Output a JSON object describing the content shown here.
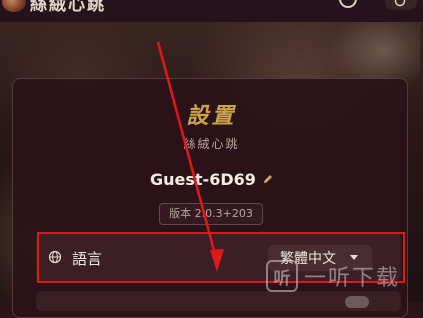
{
  "header": {
    "app_title": "絲絨心跳"
  },
  "settings": {
    "title": "設置",
    "subtitle": "絲絨心跳",
    "username": "Guest-6D69",
    "version": "版本 2.0.3+203",
    "language": {
      "label": "語言",
      "selected": "繁體中文"
    }
  },
  "watermark": {
    "icon_char": "听",
    "text": "一听下载"
  },
  "colors": {
    "accent_gold": "#cba34c",
    "highlight_red": "#e01818",
    "panel_bg": "#2c121a"
  }
}
